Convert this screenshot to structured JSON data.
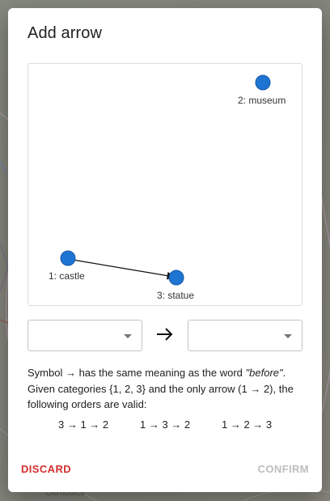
{
  "background": {
    "map_labels": [
      "Černošice"
    ]
  },
  "dialog": {
    "title": "Add arrow",
    "graph": {
      "nodes": [
        {
          "id": 1,
          "label": "1: castle"
        },
        {
          "id": 2,
          "label": "2: museum"
        },
        {
          "id": 3,
          "label": "3: statue"
        }
      ],
      "edges": [
        {
          "from": 1,
          "to": 3
        }
      ],
      "node_color": "#1e74d2"
    },
    "from_select": {
      "value": ""
    },
    "to_select": {
      "value": ""
    },
    "arrow_symbol": "→",
    "explanation": {
      "line1_prefix": "Symbol → has the same meaning as the word ",
      "line1_word": "\"before\"",
      "line1_suffix": ".",
      "line2": "Given categories {1, 2, 3} and the only arrow (1 → 2), the",
      "line3": "following orders are valid:"
    },
    "valid_orders": [
      "3 → 1 → 2",
      "1 → 3 → 2",
      "1 → 2 → 3"
    ],
    "buttons": {
      "discard": "DISCARD",
      "confirm": "CONFIRM"
    },
    "colors": {
      "discard": "#d32f2f",
      "confirm_disabled": "#bdbdbd"
    }
  }
}
